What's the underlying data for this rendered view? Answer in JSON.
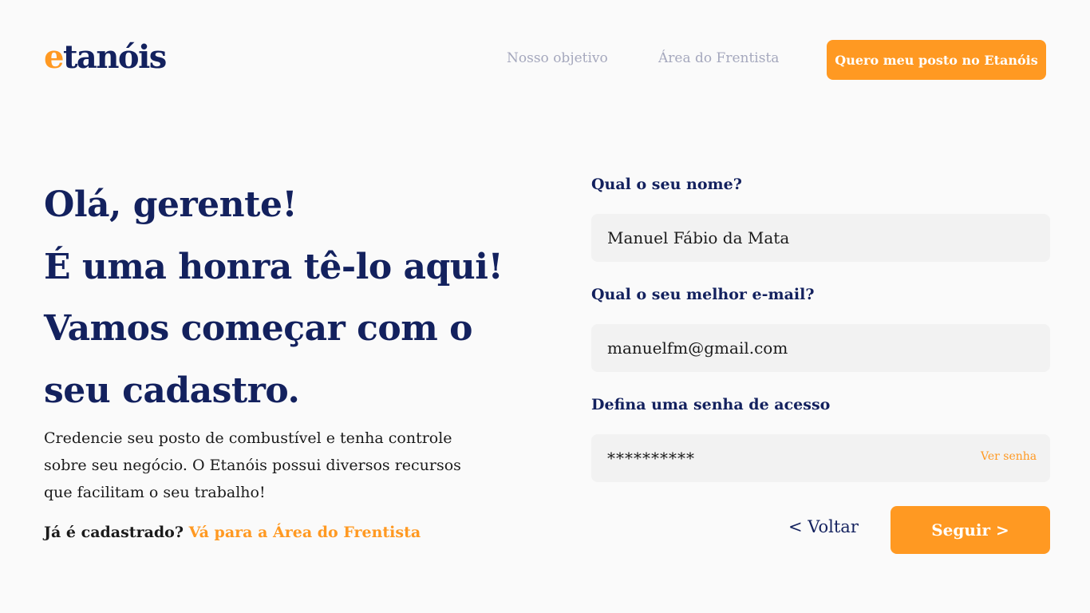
{
  "header": {
    "logo_e": "e",
    "logo_rest": "tanóis",
    "nav": [
      "Nosso objetivo",
      "Área do Frentista"
    ],
    "cta_label": "Quero meu posto no Etanóis"
  },
  "hero": {
    "headline": [
      "Olá, gerente!",
      "É uma honra tê-lo aqui!",
      "Vamos começar com o",
      "seu cadastro."
    ],
    "description": "Credencie seu posto de combustível e tenha controle sobre seu negócio. O Etanóis possui diversos recursos que facilitam o seu trabalho!",
    "already_text": "Já é cadastrado?",
    "already_link": "Vá para a Área do Frentista"
  },
  "form": {
    "name_label": "Qual o seu nome?",
    "name_value": "Manuel Fábio da Mata",
    "email_label": "Qual o seu melhor e-mail?",
    "email_value": "manuelfm@gmail.com",
    "password_label": "Defina uma senha de acesso",
    "password_display": "**********",
    "show_password": "Ver senha",
    "back_label": "< Voltar",
    "next_label": "Seguir >"
  },
  "colors": {
    "brand_navy": "#13215e",
    "accent_orange": "#ff9922",
    "nav_gray": "#a5a8bd",
    "field_bg": "#f2f2f2",
    "page_bg": "#fafafa"
  }
}
